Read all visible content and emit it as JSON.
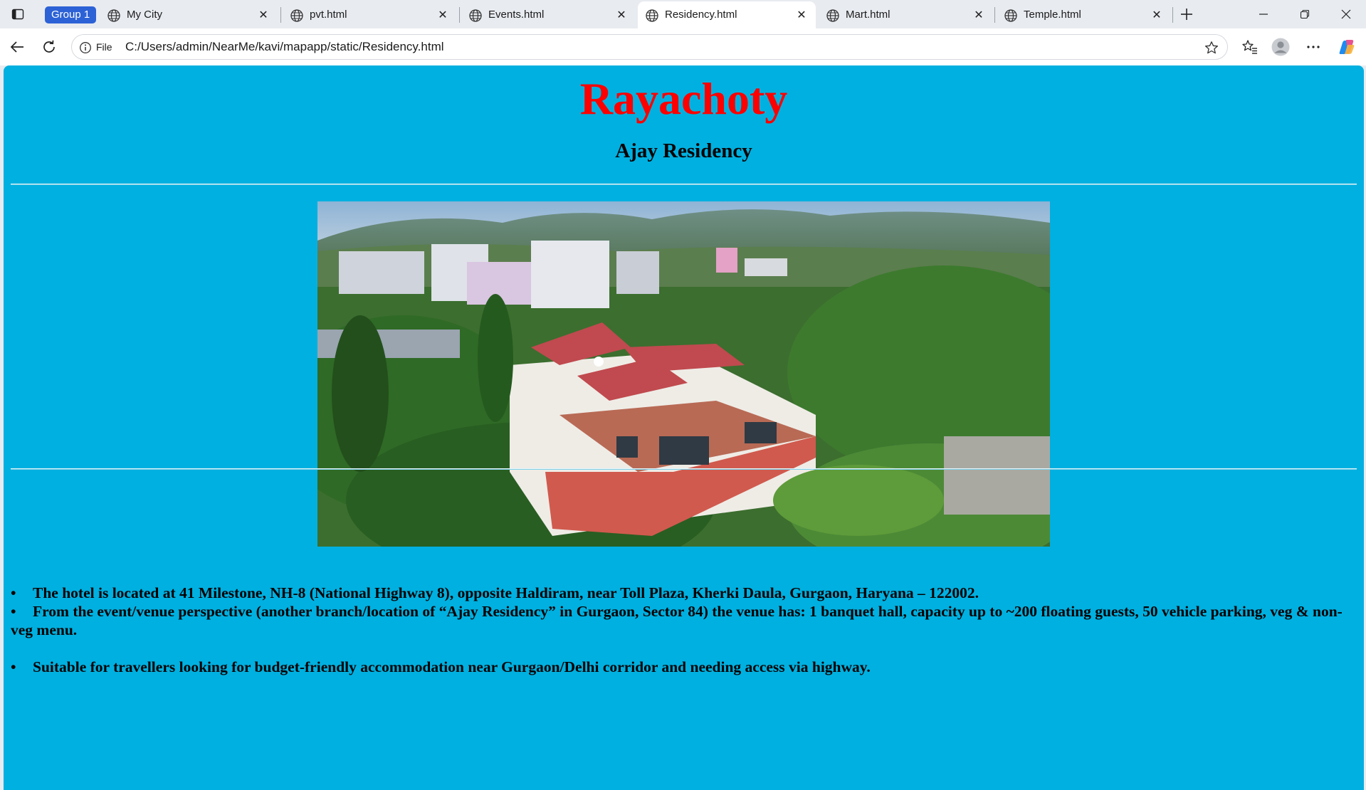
{
  "browser": {
    "group_label": "Group 1",
    "tabs": [
      {
        "title": "My City",
        "active": false
      },
      {
        "title": "pvt.html",
        "active": false
      },
      {
        "title": "Events.html",
        "active": false
      },
      {
        "title": "Residency.html",
        "active": true
      },
      {
        "title": "Mart.html",
        "active": false
      },
      {
        "title": "Temple.html",
        "active": false
      }
    ],
    "address": {
      "scheme_label": "File",
      "url": "C:/Users/admin/NearMe/kavi/mapapp/static/Residency.html"
    },
    "icons": {
      "tab_actions": "tab-actions-icon",
      "globe": "globe-icon",
      "close": "close-icon",
      "new_tab": "plus-icon",
      "back": "back-arrow-icon",
      "reload": "reload-icon",
      "info": "info-icon",
      "favorite": "star-icon",
      "favorites": "favorites-icon",
      "profile": "profile-icon",
      "menu": "more-icon",
      "copilot": "copilot-icon"
    }
  },
  "page": {
    "background": "#00b0e0",
    "title": "Rayachoty",
    "title_color": "#ff0000",
    "subtitle": "Ajay Residency",
    "bullet": "•",
    "items": [
      "The hotel is located at 41 Milestone, NH-8 (National Highway 8), opposite Haldiram, near Toll Plaza, Kherki Daula, Gurgaon, Haryana – 122002.",
      "From the event/venue perspective (another branch/location of “Ajay Residency” in Gurgaon, Sector 84) the venue has: 1 banquet hall, capacity up to ~200 floating guests, 50 vehicle parking, veg & non-veg menu.",
      "Suitable for travellers looking for budget-friendly accommodation near Gurgaon/Delhi corridor and needing access via highway."
    ]
  }
}
